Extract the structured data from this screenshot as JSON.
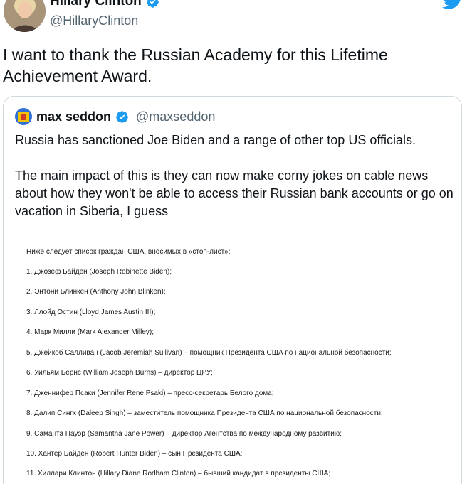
{
  "author": {
    "display_name": "Hillary Clinton",
    "handle": "@HillaryClinton"
  },
  "tweet": {
    "text": "I want to thank the Russian Academy for this Lifetime Achievement Award."
  },
  "quoted": {
    "display_name": "max seddon",
    "handle": "@maxseddon",
    "paragraph1": "Russia has sanctioned Joe Biden and a range of other top US officials.",
    "paragraph2": "The main impact of this is they can now make corny jokes on cable news about how they won't be able to access their Russian bank accounts or go on vacation in Siberia, I guess"
  },
  "document": {
    "intro": "Ниже следует список граждан США, вносимых в «стоп-лист»:",
    "items": [
      "1. Джозеф Байден (Joseph Robinette Biden);",
      "2. Энтони Блинкен (Anthony John Blinken);",
      "3. Ллойд Остин (Lloyd James Austin III);",
      "4. Марк Милли (Mark Alexander Milley);",
      "5. Джейкоб Салливан (Jacob Jeremiah Sullivan) – помощник Президента США по национальной безопасности;",
      "6. Уильям Бернс (William Joseph Burns) – директор ЦРУ;",
      "7. Дженнифер Псаки (Jennifer Rene Psaki) – пресс-секретарь Белого дома;",
      "8. Далип Сингх (Daleep Singh) – заместитель помощника Президента США по национальной безопасности;",
      "9. Саманта Пауэр (Samantha Jane Power) – директор Агентства по международному развитию;",
      "10. Хантер Байден (Robert Hunter Biden) – сын Президента США;",
      "11. Хиллари Клинтон (Hillary Diane Rodham Clinton) – бывший кандидат в президенты США;"
    ]
  },
  "colors": {
    "verified_blue": "#1d9bf0",
    "secondary_text": "#536471",
    "border": "#cfd9de"
  },
  "icons": {
    "verified": "verified-badge-icon",
    "twitter": "twitter-bird-icon"
  }
}
